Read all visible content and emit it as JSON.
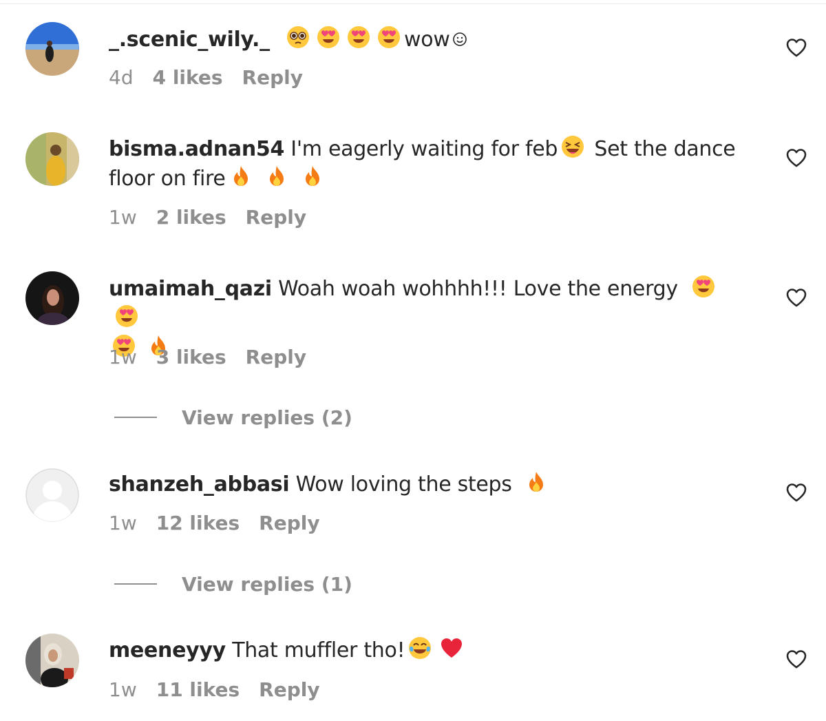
{
  "comments": [
    {
      "username": "_.scenic_wily._",
      "text": "wow",
      "time": "4d",
      "likes": "4 likes",
      "reply": "Reply"
    },
    {
      "username": "bisma.adnan54",
      "text_a": "I'm eagerly waiting for feb",
      "text_b": "Set the dance",
      "text_c": "floor on fire",
      "time": "1w",
      "likes": "2 likes",
      "reply": "Reply"
    },
    {
      "username": "umaimah_qazi",
      "text": "Woah woah wohhhh!!! Love the energy",
      "time": "1w",
      "likes": "3 likes",
      "reply": "Reply",
      "view_replies": "View replies (2)"
    },
    {
      "username": "shanzeh_abbasi",
      "text": "Wow loving the steps",
      "time": "1w",
      "likes": "12 likes",
      "reply": "Reply",
      "view_replies": "View replies (1)"
    },
    {
      "username": "meeneyyy",
      "text": "That muffler tho!",
      "time": "1w",
      "likes": "11 likes",
      "reply": "Reply"
    }
  ],
  "icons": {
    "like": "heart-outline-icon",
    "emoji_heart_eyes": "heart-eyes-emoji",
    "emoji_pleading": "pleading-face-emoji",
    "emoji_fire": "fire-emoji",
    "emoji_squint_laugh": "grinning-squinting-emoji",
    "emoji_joy": "tears-of-joy-emoji",
    "emoji_red_heart": "red-heart-emoji"
  },
  "colors": {
    "text": "#262626",
    "secondary": "#8e8e8e"
  }
}
